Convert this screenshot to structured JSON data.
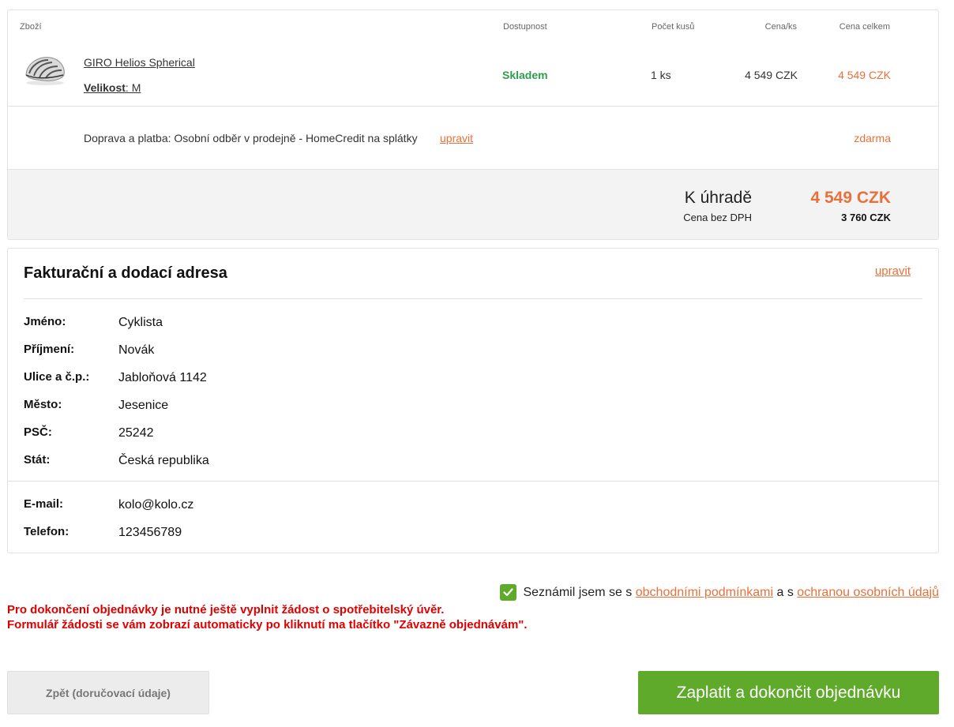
{
  "cart": {
    "headers": {
      "product": "Zboží",
      "availability": "Dostupnost",
      "quantity": "Počet kusů",
      "unit_price": "Cena/ks",
      "total_price": "Cena celkem"
    },
    "item": {
      "name": "GIRO Helios Spherical",
      "size_label": "Velikost",
      "size_value": ": M",
      "availability": "Skladem",
      "quantity": "1 ks",
      "unit_price": "4 549 CZK",
      "total_price": "4 549 CZK",
      "image_icon": "helmet-image"
    },
    "shipping": {
      "text": "Doprava a platba: Osobní odběr v prodejně - HomeCredit na splátky",
      "edit_label": "upravit",
      "price": "zdarma"
    },
    "summary": {
      "label": "K úhradě",
      "price": "4 549 CZK",
      "net_label": "Cena bez DPH",
      "net_price": "3 760 CZK"
    }
  },
  "address": {
    "title": "Fakturační a dodací adresa",
    "edit_label": "upravit",
    "fields": [
      {
        "label": "Jméno:",
        "value": "Cyklista"
      },
      {
        "label": "Příjmení:",
        "value": "Novák"
      },
      {
        "label": "Ulice a č.p.:",
        "value": "Jabloňová 1142"
      },
      {
        "label": "Město:",
        "value": "Jesenice"
      },
      {
        "label": "PSČ:",
        "value": "25242"
      },
      {
        "label": "Stát:",
        "value": "Česká republika"
      }
    ],
    "contact": [
      {
        "label": "E-mail:",
        "value": "kolo@kolo.cz"
      },
      {
        "label": "Telefon:",
        "value": "123456789"
      }
    ]
  },
  "consent": {
    "checked": true,
    "text_before": "Seznámil jsem se s ",
    "link_terms": "obchodními podmínkami",
    "text_middle": " a s ",
    "link_privacy": "ochranou osobních údajů"
  },
  "warning": {
    "line1": "Pro dokončení objednávky je nutné ještě vyplnit žádost o spotřebitelský úvěr.",
    "line2": "Formulář žádosti se vám zobrazí automaticky po kliknutí ma tlačítko \"Závazně objednávám\"."
  },
  "buttons": {
    "back": "Zpět (doručovací údaje)",
    "pay": "Zaplatit a dokončit objednávku"
  },
  "colors": {
    "accent_orange": "#e8703a",
    "stock_green": "#2e9f4c",
    "button_green": "#5fa92b",
    "warning_red": "#e00000"
  }
}
